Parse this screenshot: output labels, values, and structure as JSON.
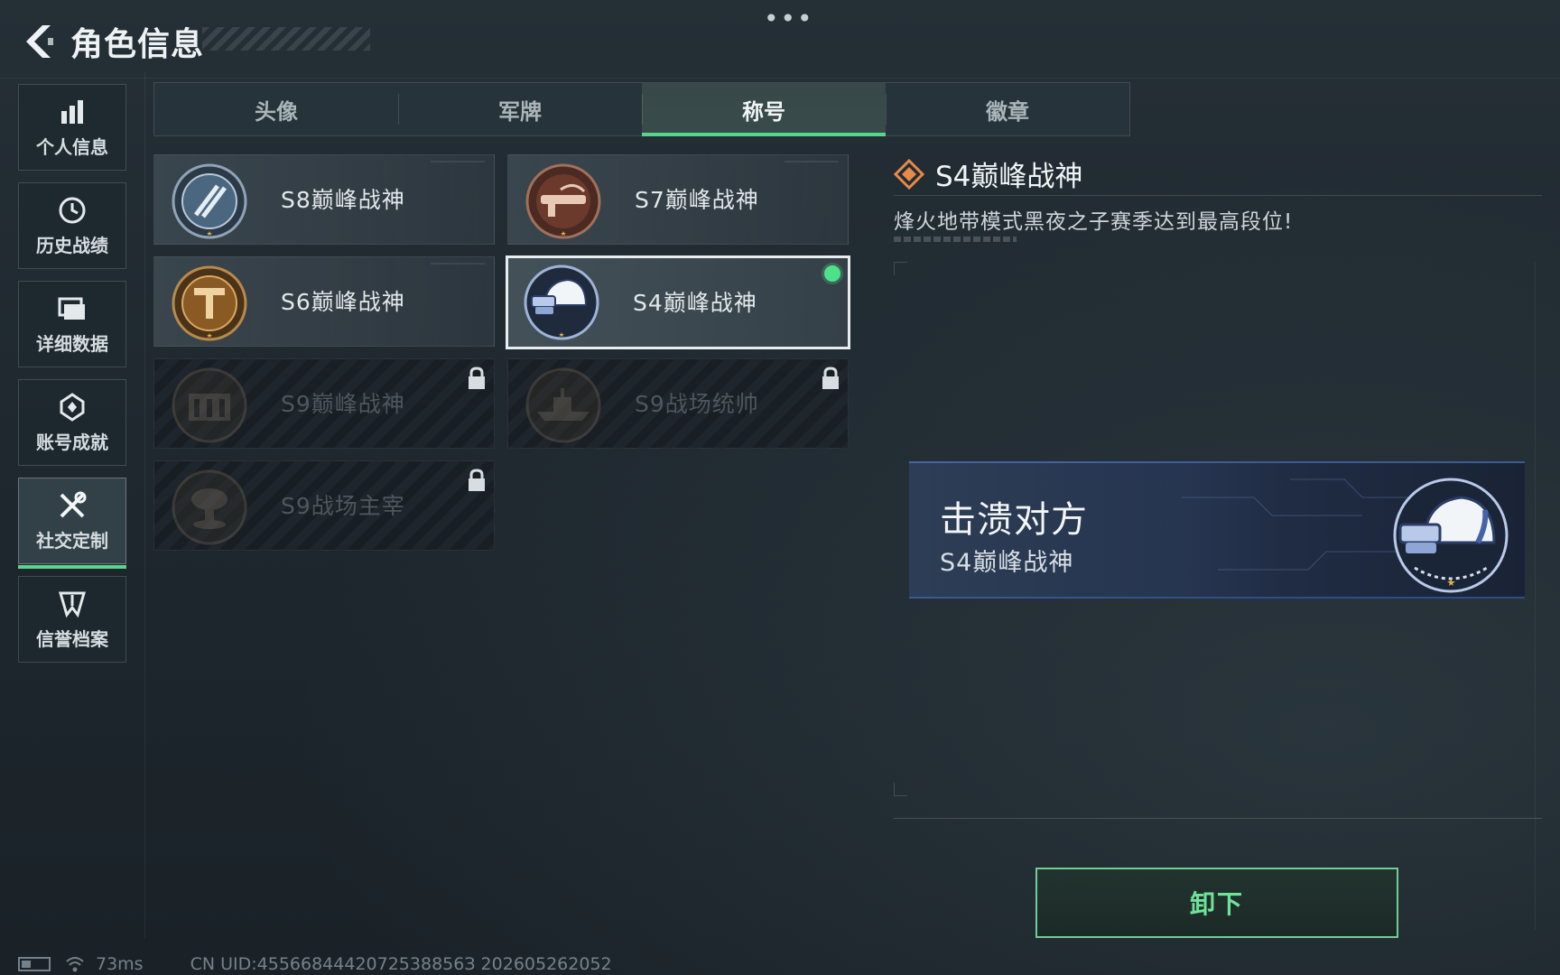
{
  "header": {
    "title": "角色信息",
    "more_label": "•••"
  },
  "sidebar": {
    "items": [
      {
        "label": "个人信息",
        "icon": "bar-chart-icon"
      },
      {
        "label": "历史战绩",
        "icon": "history-clock-icon"
      },
      {
        "label": "详细数据",
        "icon": "folder-icon"
      },
      {
        "label": "账号成就",
        "icon": "achievement-icon"
      },
      {
        "label": "社交定制",
        "icon": "tools-icon",
        "active": true
      },
      {
        "label": "信誉档案",
        "icon": "credit-shield-icon"
      }
    ]
  },
  "tabs": [
    {
      "label": "头像"
    },
    {
      "label": "军牌"
    },
    {
      "label": "称号",
      "active": true
    },
    {
      "label": "徽章"
    }
  ],
  "titles": [
    {
      "name": "S8巅峰战神",
      "locked": false,
      "emblem": "s8-emblem"
    },
    {
      "name": "S7巅峰战神",
      "locked": false,
      "emblem": "s7-emblem"
    },
    {
      "name": "S6巅峰战神",
      "locked": false,
      "emblem": "s6-emblem"
    },
    {
      "name": "S4巅峰战神",
      "locked": false,
      "selected": true,
      "equipped": true,
      "emblem": "s4-helmet-emblem"
    },
    {
      "name": "S9巅峰战神",
      "locked": true,
      "emblem": "s9-building-emblem"
    },
    {
      "name": "S9战场统帅",
      "locked": true,
      "emblem": "s9-ship-emblem"
    },
    {
      "name": "S9战场主宰",
      "locked": true,
      "emblem": "s9-mushroom-cloud-emblem"
    }
  ],
  "detail": {
    "title": "S4巅峰战神",
    "description": "烽火地带模式黑夜之子赛季达到最高段位!"
  },
  "banner": {
    "main_text": "击溃对方",
    "sub_text": "S4巅峰战神"
  },
  "actions": {
    "unequip_label": "卸下"
  },
  "status": {
    "ping": "73ms",
    "uid": "CN UID:4556684442072538856З 202605262052"
  },
  "colors": {
    "accent_green": "#58d48c",
    "equipped_dot": "#4fe08a",
    "banner_blue": "#2e4d86"
  }
}
